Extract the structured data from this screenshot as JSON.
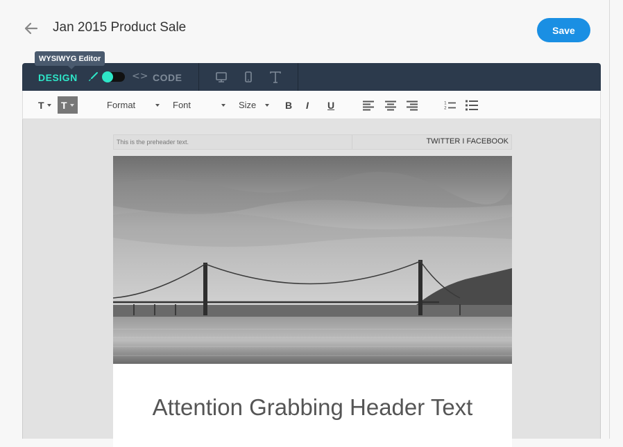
{
  "header": {
    "title": "Jan 2015 Product Sale",
    "save_label": "Save"
  },
  "tooltip": "WYSIWYG Editor",
  "modebar": {
    "design_label": "DESIGN",
    "code_icon": "<>",
    "code_label": "CODE",
    "toggle_on": true
  },
  "toolbar": {
    "text_color_label": "T",
    "bg_color_label": "T",
    "format_label": "Format",
    "font_label": "Font",
    "size_label": "Size",
    "bold": "B",
    "italic": "I",
    "underline": "U"
  },
  "email": {
    "preheader_text": "This is the preheader text.",
    "social_links": "TWITTER I FACEBOOK",
    "headline": "Attention Grabbing Header Text"
  },
  "colors": {
    "accent": "#2ee6c8",
    "save": "#1a8fe3",
    "modebar": "#2c3a4c"
  }
}
